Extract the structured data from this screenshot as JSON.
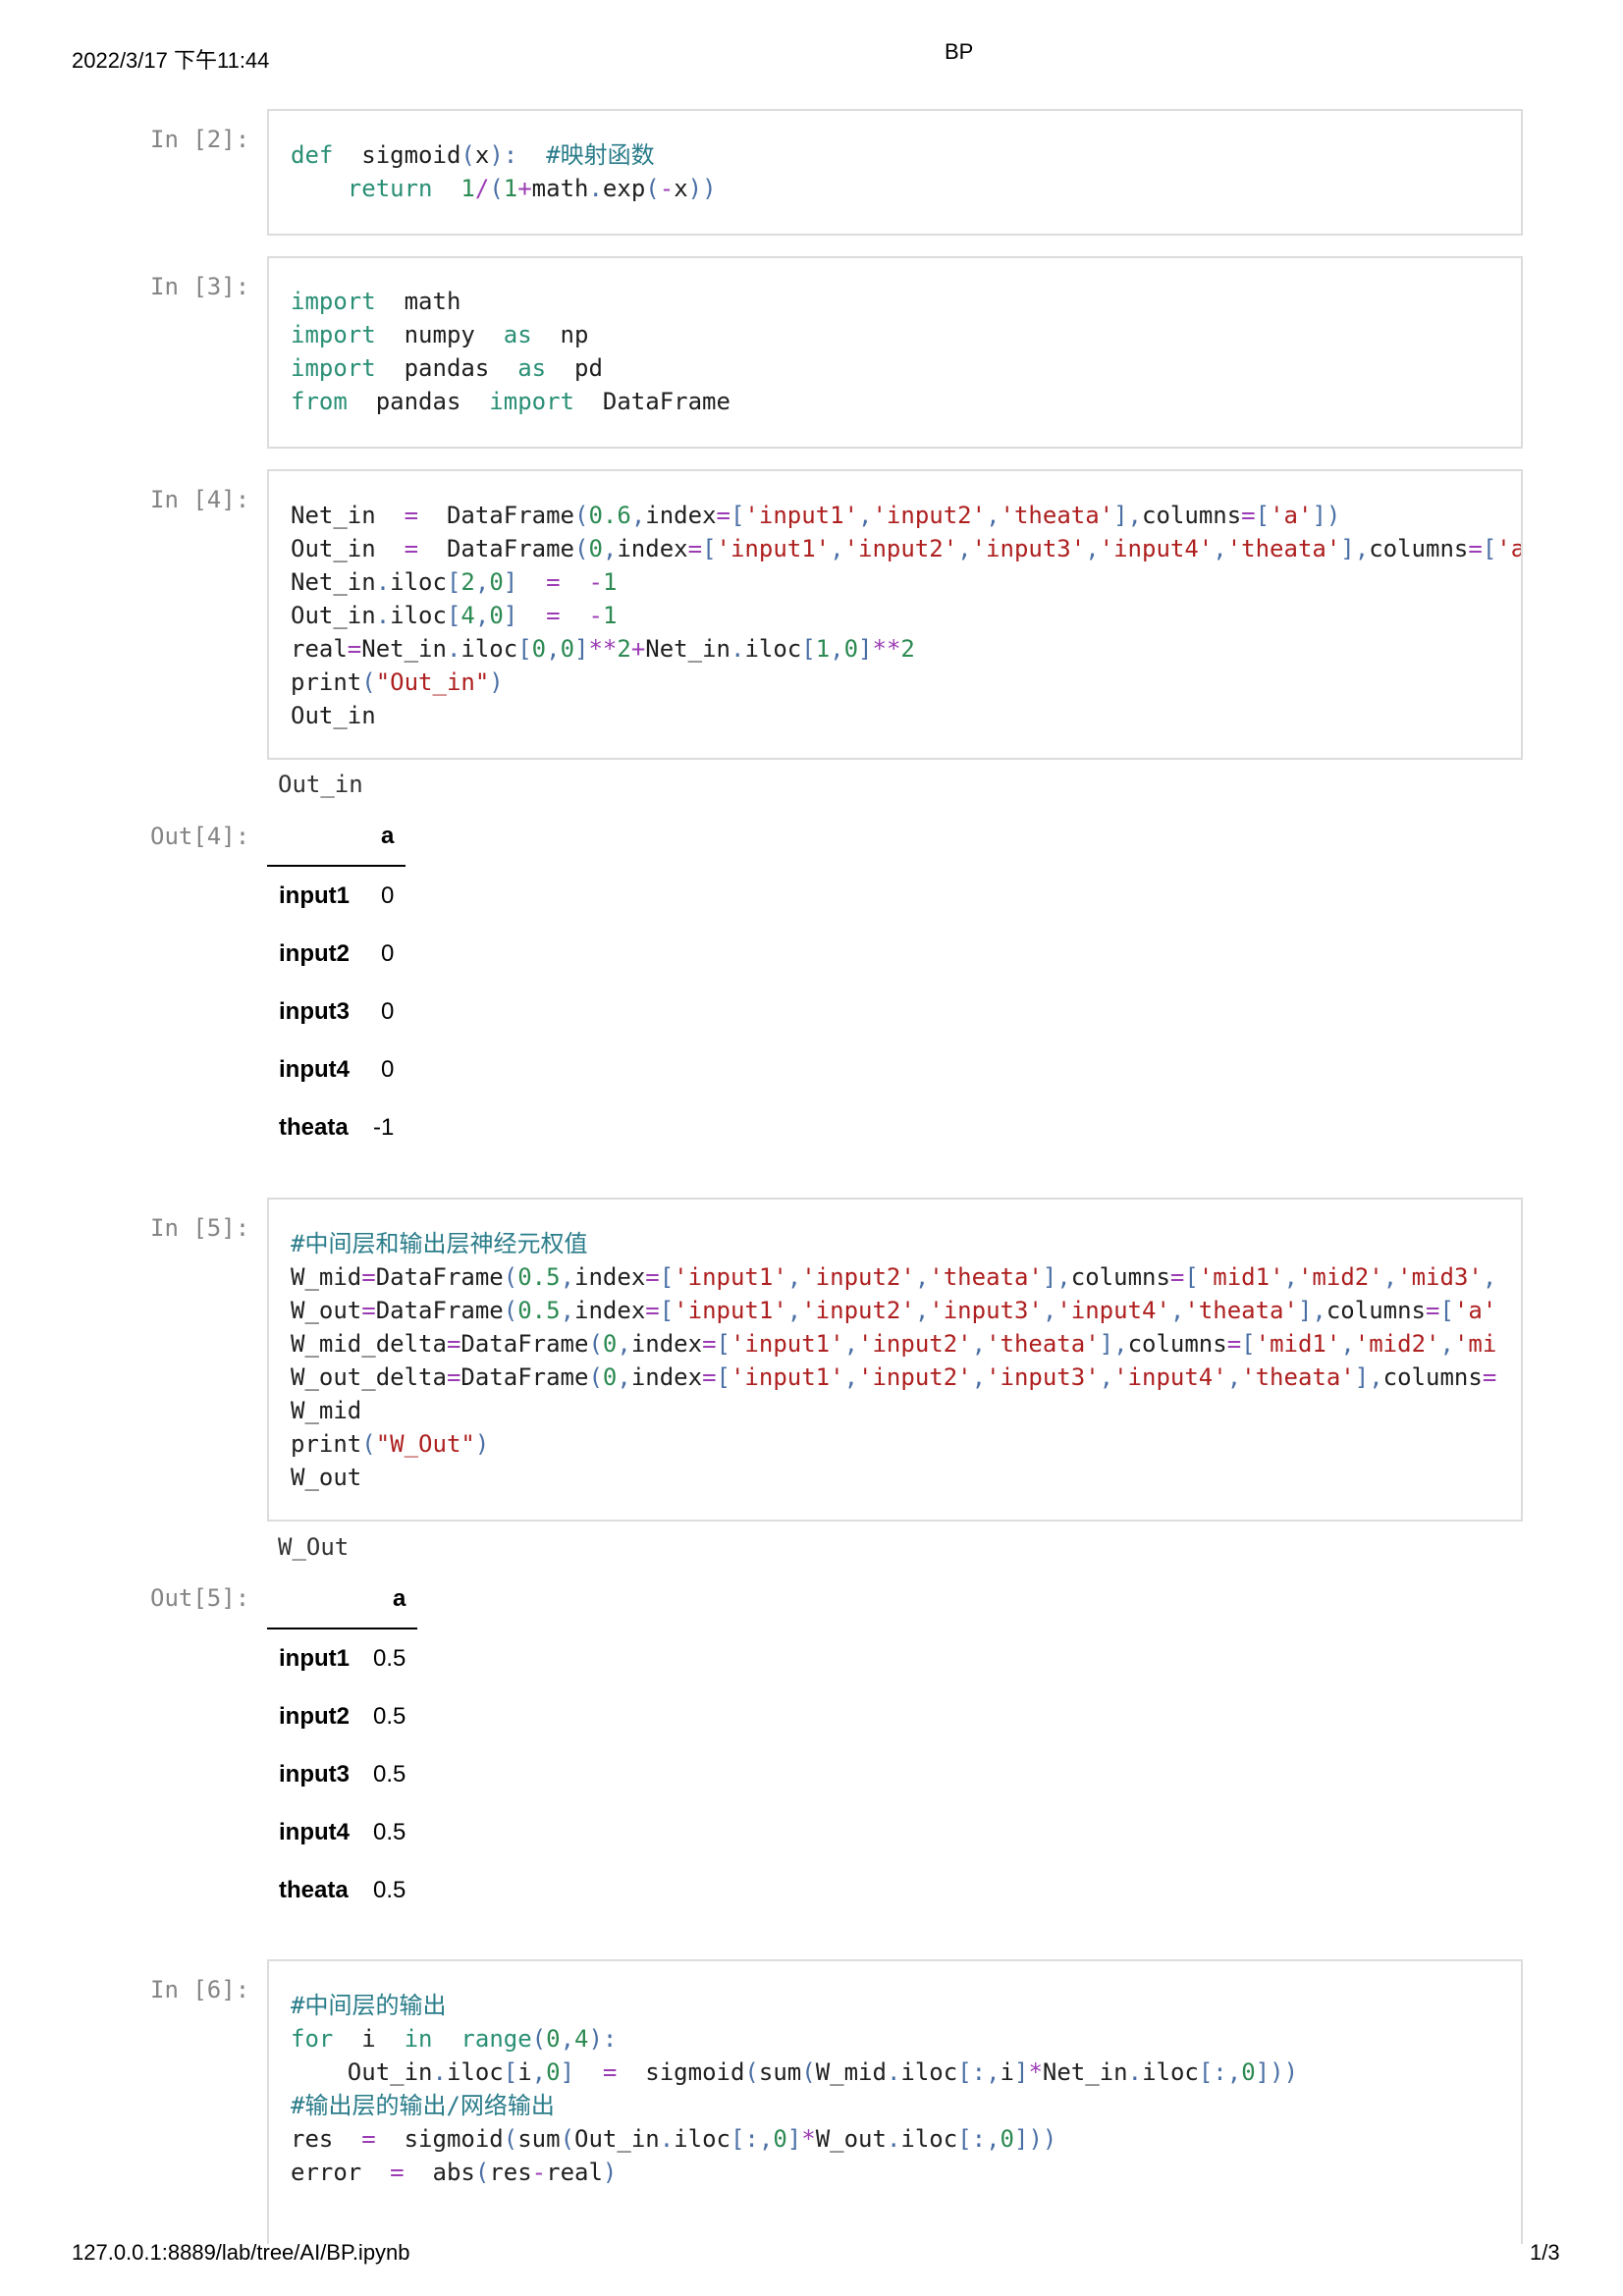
{
  "header": {
    "datetime": "2022/3/17 下午11:44",
    "title": "BP"
  },
  "footer": {
    "url": "127.0.0.1:8889/lab/tree/AI/BP.ipynb",
    "page": "1/3"
  },
  "cells": {
    "c2": {
      "prompt": "In [2]:"
    },
    "c3": {
      "prompt": "In [3]:"
    },
    "c4": {
      "prompt": "In [4]:",
      "stdout": "Out_in",
      "out_prompt": "Out[4]:"
    },
    "c5": {
      "prompt": "In [5]:",
      "stdout": "W_Out",
      "out_prompt": "Out[5]:"
    },
    "c6": {
      "prompt": "In [6]:"
    }
  },
  "out4_table": {
    "column": "a",
    "rows": [
      {
        "index": "input1",
        "value": "0"
      },
      {
        "index": "input2",
        "value": "0"
      },
      {
        "index": "input3",
        "value": "0"
      },
      {
        "index": "input4",
        "value": "0"
      },
      {
        "index": "theata",
        "value": "-1"
      }
    ]
  },
  "out5_table": {
    "column": "a",
    "rows": [
      {
        "index": "input1",
        "value": "0.5"
      },
      {
        "index": "input2",
        "value": "0.5"
      },
      {
        "index": "input3",
        "value": "0.5"
      },
      {
        "index": "input4",
        "value": "0.5"
      },
      {
        "index": "theata",
        "value": "0.5"
      }
    ]
  },
  "code": {
    "c2": [
      [
        [
          "kw",
          "def"
        ],
        [
          "",
          "  sigmoid"
        ],
        [
          "pu",
          "("
        ],
        [
          "",
          "x"
        ],
        [
          "pu",
          "):"
        ],
        [
          "",
          "  "
        ],
        [
          "cm",
          "#映射函数"
        ]
      ],
      [
        [
          "",
          "    "
        ],
        [
          "kw",
          "return"
        ],
        [
          "",
          "  "
        ],
        [
          "nu",
          "1"
        ],
        [
          "op",
          "/"
        ],
        [
          "pu",
          "("
        ],
        [
          "nu",
          "1"
        ],
        [
          "op",
          "+"
        ],
        [
          "",
          "math"
        ],
        [
          "pu",
          "."
        ],
        [
          "",
          "exp"
        ],
        [
          "pu",
          "("
        ],
        [
          "op",
          "-"
        ],
        [
          "",
          "x"
        ],
        [
          "pu",
          "))"
        ]
      ]
    ],
    "c3": [
      [
        [
          "kw",
          "import"
        ],
        [
          "",
          "  math"
        ]
      ],
      [
        [
          "kw",
          "import"
        ],
        [
          "",
          "  numpy  "
        ],
        [
          "kw",
          "as"
        ],
        [
          "",
          "  np"
        ]
      ],
      [
        [
          "kw",
          "import"
        ],
        [
          "",
          "  pandas  "
        ],
        [
          "kw",
          "as"
        ],
        [
          "",
          "  pd"
        ]
      ],
      [
        [
          "kw",
          "from"
        ],
        [
          "",
          "  pandas  "
        ],
        [
          "kw",
          "import"
        ],
        [
          "",
          "  DataFrame"
        ]
      ]
    ],
    "c4": [
      [
        [
          "",
          "Net_in  "
        ],
        [
          "op",
          "="
        ],
        [
          "",
          "  DataFrame"
        ],
        [
          "pu",
          "("
        ],
        [
          "nu",
          "0.6"
        ],
        [
          "pu",
          ","
        ],
        [
          "",
          "index"
        ],
        [
          "op",
          "="
        ],
        [
          "pu",
          "["
        ],
        [
          "st",
          "'input1'"
        ],
        [
          "pu",
          ","
        ],
        [
          "st",
          "'input2'"
        ],
        [
          "pu",
          ","
        ],
        [
          "st",
          "'theata'"
        ],
        [
          "pu",
          "],"
        ],
        [
          "",
          "columns"
        ],
        [
          "op",
          "="
        ],
        [
          "pu",
          "["
        ],
        [
          "st",
          "'a'"
        ],
        [
          "pu",
          "])"
        ]
      ],
      [
        [
          "",
          "Out_in  "
        ],
        [
          "op",
          "="
        ],
        [
          "",
          "  DataFrame"
        ],
        [
          "pu",
          "("
        ],
        [
          "nu",
          "0"
        ],
        [
          "pu",
          ","
        ],
        [
          "",
          "index"
        ],
        [
          "op",
          "="
        ],
        [
          "pu",
          "["
        ],
        [
          "st",
          "'input1'"
        ],
        [
          "pu",
          ","
        ],
        [
          "st",
          "'input2'"
        ],
        [
          "pu",
          ","
        ],
        [
          "st",
          "'input3'"
        ],
        [
          "pu",
          ","
        ],
        [
          "st",
          "'input4'"
        ],
        [
          "pu",
          ","
        ],
        [
          "st",
          "'theata'"
        ],
        [
          "pu",
          "],"
        ],
        [
          "",
          "columns"
        ],
        [
          "op",
          "="
        ],
        [
          "pu",
          "["
        ],
        [
          "st",
          "'a"
        ]
      ],
      [
        [
          "",
          "Net_in"
        ],
        [
          "pu",
          "."
        ],
        [
          "",
          "iloc"
        ],
        [
          "pu",
          "["
        ],
        [
          "nu",
          "2"
        ],
        [
          "pu",
          ","
        ],
        [
          "nu",
          "0"
        ],
        [
          "pu",
          "]"
        ],
        [
          "",
          "  "
        ],
        [
          "op",
          "="
        ],
        [
          "",
          "  "
        ],
        [
          "op",
          "-"
        ],
        [
          "nu",
          "1"
        ]
      ],
      [
        [
          "",
          "Out_in"
        ],
        [
          "pu",
          "."
        ],
        [
          "",
          "iloc"
        ],
        [
          "pu",
          "["
        ],
        [
          "nu",
          "4"
        ],
        [
          "pu",
          ","
        ],
        [
          "nu",
          "0"
        ],
        [
          "pu",
          "]"
        ],
        [
          "",
          "  "
        ],
        [
          "op",
          "="
        ],
        [
          "",
          "  "
        ],
        [
          "op",
          "-"
        ],
        [
          "nu",
          "1"
        ]
      ],
      [
        [
          "",
          "real"
        ],
        [
          "op",
          "="
        ],
        [
          "",
          "Net_in"
        ],
        [
          "pu",
          "."
        ],
        [
          "",
          "iloc"
        ],
        [
          "pu",
          "["
        ],
        [
          "nu",
          "0"
        ],
        [
          "pu",
          ","
        ],
        [
          "nu",
          "0"
        ],
        [
          "pu",
          "]"
        ],
        [
          "op",
          "**"
        ],
        [
          "nu",
          "2"
        ],
        [
          "op",
          "+"
        ],
        [
          "",
          "Net_in"
        ],
        [
          "pu",
          "."
        ],
        [
          "",
          "iloc"
        ],
        [
          "pu",
          "["
        ],
        [
          "nu",
          "1"
        ],
        [
          "pu",
          ","
        ],
        [
          "nu",
          "0"
        ],
        [
          "pu",
          "]"
        ],
        [
          "op",
          "**"
        ],
        [
          "nu",
          "2"
        ]
      ],
      [
        [
          "",
          "print"
        ],
        [
          "pu",
          "("
        ],
        [
          "st",
          "\"Out_in\""
        ],
        [
          "pu",
          ")"
        ]
      ],
      [
        [
          "",
          "Out_in"
        ]
      ]
    ],
    "c5": [
      [
        [
          "cm",
          "#中间层和输出层神经元权值"
        ]
      ],
      [
        [
          "",
          "W_mid"
        ],
        [
          "op",
          "="
        ],
        [
          "",
          "DataFrame"
        ],
        [
          "pu",
          "("
        ],
        [
          "nu",
          "0.5"
        ],
        [
          "pu",
          ","
        ],
        [
          "",
          "index"
        ],
        [
          "op",
          "="
        ],
        [
          "pu",
          "["
        ],
        [
          "st",
          "'input1'"
        ],
        [
          "pu",
          ","
        ],
        [
          "st",
          "'input2'"
        ],
        [
          "pu",
          ","
        ],
        [
          "st",
          "'theata'"
        ],
        [
          "pu",
          "],"
        ],
        [
          "",
          "columns"
        ],
        [
          "op",
          "="
        ],
        [
          "pu",
          "["
        ],
        [
          "st",
          "'mid1'"
        ],
        [
          "pu",
          ","
        ],
        [
          "st",
          "'mid2'"
        ],
        [
          "pu",
          ","
        ],
        [
          "st",
          "'mid3'"
        ],
        [
          "pu",
          ","
        ]
      ],
      [
        [
          "",
          "W_out"
        ],
        [
          "op",
          "="
        ],
        [
          "",
          "DataFrame"
        ],
        [
          "pu",
          "("
        ],
        [
          "nu",
          "0.5"
        ],
        [
          "pu",
          ","
        ],
        [
          "",
          "index"
        ],
        [
          "op",
          "="
        ],
        [
          "pu",
          "["
        ],
        [
          "st",
          "'input1'"
        ],
        [
          "pu",
          ","
        ],
        [
          "st",
          "'input2'"
        ],
        [
          "pu",
          ","
        ],
        [
          "st",
          "'input3'"
        ],
        [
          "pu",
          ","
        ],
        [
          "st",
          "'input4'"
        ],
        [
          "pu",
          ","
        ],
        [
          "st",
          "'theata'"
        ],
        [
          "pu",
          "],"
        ],
        [
          "",
          "columns"
        ],
        [
          "op",
          "="
        ],
        [
          "pu",
          "["
        ],
        [
          "st",
          "'a'"
        ]
      ],
      [
        [
          "",
          "W_mid_delta"
        ],
        [
          "op",
          "="
        ],
        [
          "",
          "DataFrame"
        ],
        [
          "pu",
          "("
        ],
        [
          "nu",
          "0"
        ],
        [
          "pu",
          ","
        ],
        [
          "",
          "index"
        ],
        [
          "op",
          "="
        ],
        [
          "pu",
          "["
        ],
        [
          "st",
          "'input1'"
        ],
        [
          "pu",
          ","
        ],
        [
          "st",
          "'input2'"
        ],
        [
          "pu",
          ","
        ],
        [
          "st",
          "'theata'"
        ],
        [
          "pu",
          "],"
        ],
        [
          "",
          "columns"
        ],
        [
          "op",
          "="
        ],
        [
          "pu",
          "["
        ],
        [
          "st",
          "'mid1'"
        ],
        [
          "pu",
          ","
        ],
        [
          "st",
          "'mid2'"
        ],
        [
          "pu",
          ","
        ],
        [
          "st",
          "'mi"
        ]
      ],
      [
        [
          "",
          "W_out_delta"
        ],
        [
          "op",
          "="
        ],
        [
          "",
          "DataFrame"
        ],
        [
          "pu",
          "("
        ],
        [
          "nu",
          "0"
        ],
        [
          "pu",
          ","
        ],
        [
          "",
          "index"
        ],
        [
          "op",
          "="
        ],
        [
          "pu",
          "["
        ],
        [
          "st",
          "'input1'"
        ],
        [
          "pu",
          ","
        ],
        [
          "st",
          "'input2'"
        ],
        [
          "pu",
          ","
        ],
        [
          "st",
          "'input3'"
        ],
        [
          "pu",
          ","
        ],
        [
          "st",
          "'input4'"
        ],
        [
          "pu",
          ","
        ],
        [
          "st",
          "'theata'"
        ],
        [
          "pu",
          "],"
        ],
        [
          "",
          "columns"
        ],
        [
          "op",
          "="
        ]
      ],
      [
        [
          "",
          "W_mid"
        ]
      ],
      [
        [
          "",
          "print"
        ],
        [
          "pu",
          "("
        ],
        [
          "st",
          "\"W_Out\""
        ],
        [
          "pu",
          ")"
        ]
      ],
      [
        [
          "",
          "W_out"
        ]
      ]
    ],
    "c6": [
      [
        [
          "cm",
          "#中间层的输出"
        ]
      ],
      [
        [
          "kw",
          "for"
        ],
        [
          "",
          "  i  "
        ],
        [
          "kw",
          "in"
        ],
        [
          "",
          "  "
        ],
        [
          "kw",
          "range"
        ],
        [
          "pu",
          "("
        ],
        [
          "nu",
          "0"
        ],
        [
          "pu",
          ","
        ],
        [
          "nu",
          "4"
        ],
        [
          "pu",
          "):"
        ]
      ],
      [
        [
          "",
          "    Out_in"
        ],
        [
          "pu",
          "."
        ],
        [
          "",
          "iloc"
        ],
        [
          "pu",
          "["
        ],
        [
          "",
          "i"
        ],
        [
          "pu",
          ","
        ],
        [
          "nu",
          "0"
        ],
        [
          "pu",
          "]"
        ],
        [
          "",
          "  "
        ],
        [
          "op",
          "="
        ],
        [
          "",
          "  sigmoid"
        ],
        [
          "pu",
          "("
        ],
        [
          "",
          "sum"
        ],
        [
          "pu",
          "("
        ],
        [
          "",
          "W_mid"
        ],
        [
          "pu",
          "."
        ],
        [
          "",
          "iloc"
        ],
        [
          "pu",
          "[:,"
        ],
        [
          "",
          "i"
        ],
        [
          "pu",
          "]"
        ],
        [
          "op",
          "*"
        ],
        [
          "",
          "Net_in"
        ],
        [
          "pu",
          "."
        ],
        [
          "",
          "iloc"
        ],
        [
          "pu",
          "[:,"
        ],
        [
          "nu",
          "0"
        ],
        [
          "pu",
          "]))"
        ]
      ],
      [
        [
          "cm",
          "#输出层的输出/网络输出"
        ]
      ],
      [
        [
          "",
          "res  "
        ],
        [
          "op",
          "="
        ],
        [
          "",
          "  sigmoid"
        ],
        [
          "pu",
          "("
        ],
        [
          "",
          "sum"
        ],
        [
          "pu",
          "("
        ],
        [
          "",
          "Out_in"
        ],
        [
          "pu",
          "."
        ],
        [
          "",
          "iloc"
        ],
        [
          "pu",
          "[:,"
        ],
        [
          "nu",
          "0"
        ],
        [
          "pu",
          "]"
        ],
        [
          "op",
          "*"
        ],
        [
          "",
          "W_out"
        ],
        [
          "pu",
          "."
        ],
        [
          "",
          "iloc"
        ],
        [
          "pu",
          "[:,"
        ],
        [
          "nu",
          "0"
        ],
        [
          "pu",
          "]))"
        ]
      ],
      [
        [
          "",
          "error  "
        ],
        [
          "op",
          "="
        ],
        [
          "",
          "  abs"
        ],
        [
          "pu",
          "("
        ],
        [
          "",
          "res"
        ],
        [
          "op",
          "-"
        ],
        [
          "",
          "real"
        ],
        [
          "pu",
          ")"
        ]
      ]
    ]
  }
}
